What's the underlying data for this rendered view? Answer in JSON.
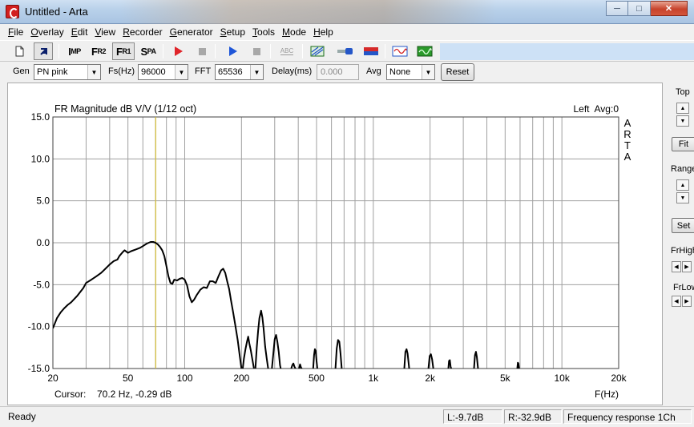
{
  "window": {
    "title": "Untitled - Arta"
  },
  "menu": [
    {
      "label": "File",
      "ul": "F",
      "rest": "ile"
    },
    {
      "label": "Overlay",
      "ul": "O",
      "rest": "verlay"
    },
    {
      "label": "Edit",
      "ul": "E",
      "rest": "dit"
    },
    {
      "label": "View",
      "ul": "V",
      "rest": "iew"
    },
    {
      "label": "Recorder",
      "ul": "R",
      "rest": "ecorder"
    },
    {
      "label": "Generator",
      "ul": "G",
      "rest": "enerator"
    },
    {
      "label": "Setup",
      "ul": "S",
      "rest": "etup"
    },
    {
      "label": "Tools",
      "ul": "T",
      "rest": "ools"
    },
    {
      "label": "Mode",
      "ul": "M",
      "rest": "ode"
    },
    {
      "label": "Help",
      "ul": "H",
      "rest": "elp"
    }
  ],
  "toolbar": {
    "imp": {
      "big": "I",
      "small": "MP"
    },
    "fr2": {
      "big": "F",
      "small": "R2"
    },
    "fr1": {
      "big": "F",
      "small": "R1"
    },
    "spa": {
      "big": "S",
      "small": "PA"
    },
    "abc": "ABC",
    "icons": [
      "new-document-icon",
      "cursor-arrow-icon",
      "record-icon",
      "stop-icon",
      "play-icon",
      "stop-icon",
      "abc-icon",
      "grid-window-icon",
      "probe-icon",
      "level-meter-icon",
      "waveform-icon",
      "oscilloscope-icon"
    ],
    "colors": {
      "record": "#e0252a",
      "play": "#1f56d8",
      "accent_green": "#2b9a2b",
      "accent_blue": "#2456c8",
      "accent_red": "#d62a2a"
    }
  },
  "genbar": {
    "gen_label": "Gen",
    "gen_value": "PN pink",
    "fs_label": "Fs(Hz)",
    "fs_value": "96000",
    "fft_label": "FFT",
    "fft_value": "65536",
    "delay_label": "Delay(ms)",
    "delay_value": "0.000",
    "avg_label": "Avg",
    "avg_value": "None",
    "reset_label": "Reset"
  },
  "chart_data": {
    "type": "line",
    "title": "FR Magnitude dB V/V (1/12 oct)",
    "channel_info": "Left  Avg:0",
    "side_label": [
      "A",
      "R",
      "T",
      "A"
    ],
    "xlabel": "F(Hz)",
    "xscale": "log",
    "xlim": [
      20,
      20000
    ],
    "ylim": [
      -15,
      15
    ],
    "y_ticks": [
      "15.0",
      "10.0",
      "5.0",
      "0.0",
      "-5.0",
      "-10.0",
      "-15.0"
    ],
    "x_ticks": [
      {
        "f": 20,
        "label": "20"
      },
      {
        "f": 50,
        "label": "50"
      },
      {
        "f": 100,
        "label": "100"
      },
      {
        "f": 200,
        "label": "200"
      },
      {
        "f": 500,
        "label": "500"
      },
      {
        "f": 1000,
        "label": "1k"
      },
      {
        "f": 2000,
        "label": "2k"
      },
      {
        "f": 5000,
        "label": "5k"
      },
      {
        "f": 10000,
        "label": "10k"
      },
      {
        "f": 20000,
        "label": "20k"
      }
    ],
    "grid": true,
    "cursor": {
      "label": "Cursor:",
      "text": "70.2 Hz, -0.29 dB",
      "f": 70.2,
      "color": "#d8c23a"
    },
    "series": [
      {
        "color": "#000000",
        "points": [
          [
            20,
            -10.2
          ],
          [
            21,
            -9.0
          ],
          [
            22,
            -8.3
          ],
          [
            23,
            -7.8
          ],
          [
            24,
            -7.4
          ],
          [
            25,
            -7.1
          ],
          [
            27,
            -6.3
          ],
          [
            29,
            -5.4
          ],
          [
            30,
            -4.8
          ],
          [
            32,
            -4.4
          ],
          [
            34,
            -4.0
          ],
          [
            36,
            -3.6
          ],
          [
            38,
            -3.1
          ],
          [
            40,
            -2.6
          ],
          [
            42,
            -2.2
          ],
          [
            44,
            -2.0
          ],
          [
            45,
            -1.6
          ],
          [
            47,
            -1.1
          ],
          [
            48,
            -0.9
          ],
          [
            50,
            -1.2
          ],
          [
            52,
            -1.0
          ],
          [
            55,
            -0.8
          ],
          [
            58,
            -0.6
          ],
          [
            60,
            -0.4
          ],
          [
            63,
            -0.1
          ],
          [
            66,
            0.1
          ],
          [
            68,
            0.1
          ],
          [
            70,
            0.0
          ],
          [
            72,
            -0.2
          ],
          [
            74,
            -0.5
          ],
          [
            76,
            -0.9
          ],
          [
            78,
            -1.6
          ],
          [
            80,
            -2.8
          ],
          [
            82,
            -4.0
          ],
          [
            84,
            -4.8
          ],
          [
            86,
            -4.9
          ],
          [
            88,
            -4.4
          ],
          [
            91,
            -4.5
          ],
          [
            94,
            -4.3
          ],
          [
            97,
            -4.2
          ],
          [
            100,
            -4.4
          ],
          [
            103,
            -5.1
          ],
          [
            106,
            -6.4
          ],
          [
            109,
            -7.1
          ],
          [
            112,
            -6.8
          ],
          [
            116,
            -6.2
          ],
          [
            121,
            -5.6
          ],
          [
            126,
            -5.3
          ],
          [
            131,
            -5.4
          ],
          [
            136,
            -4.6
          ],
          [
            141,
            -4.6
          ],
          [
            146,
            -4.8
          ],
          [
            151,
            -4.0
          ],
          [
            156,
            -3.3
          ],
          [
            160,
            -3.1
          ],
          [
            164,
            -3.6
          ],
          [
            168,
            -4.6
          ],
          [
            172,
            -5.5
          ],
          [
            176,
            -6.9
          ],
          [
            181,
            -8.4
          ],
          [
            186,
            -10.0
          ],
          [
            191,
            -11.6
          ],
          [
            196,
            -13.6
          ],
          [
            200,
            -15.0
          ]
        ],
        "segments": [
          [
            [
              203,
              -15.0
            ],
            [
              206,
              -13.8
            ],
            [
              210,
              -12.7
            ],
            [
              214,
              -11.8
            ],
            [
              217,
              -11.2
            ],
            [
              220,
              -12.0
            ],
            [
              224,
              -12.8
            ],
            [
              228,
              -13.8
            ],
            [
              233,
              -15.0
            ]
          ],
          [
            [
              237,
              -15.0
            ],
            [
              241,
              -12.5
            ],
            [
              245,
              -10.5
            ],
            [
              249,
              -9.0
            ],
            [
              254,
              -8.1
            ],
            [
              258,
              -8.9
            ],
            [
              262,
              -10.2
            ],
            [
              267,
              -12.4
            ],
            [
              272,
              -13.8
            ],
            [
              277,
              -15.0
            ]
          ],
          [
            [
              290,
              -15.0
            ],
            [
              295,
              -13.2
            ],
            [
              300,
              -11.5
            ],
            [
              305,
              -11.0
            ],
            [
              310,
              -11.8
            ],
            [
              315,
              -13.0
            ],
            [
              320,
              -14.6
            ],
            [
              323,
              -15.0
            ]
          ],
          [
            [
              367,
              -15.0
            ],
            [
              372,
              -14.6
            ],
            [
              377,
              -14.4
            ],
            [
              382,
              -14.8
            ],
            [
              387,
              -15.0
            ]
          ],
          [
            [
              404,
              -15.0
            ],
            [
              409,
              -14.5
            ],
            [
              414,
              -14.9
            ],
            [
              418,
              -15.0
            ]
          ],
          [
            [
              480,
              -15.0
            ],
            [
              485,
              -13.4
            ],
            [
              490,
              -12.7
            ],
            [
              495,
              -12.9
            ],
            [
              500,
              -14.1
            ],
            [
              505,
              -15.0
            ]
          ],
          [
            [
              630,
              -15.0
            ],
            [
              640,
              -12.6
            ],
            [
              650,
              -11.6
            ],
            [
              660,
              -11.8
            ],
            [
              670,
              -13.2
            ],
            [
              680,
              -15.0
            ]
          ],
          [
            [
              1460,
              -15.0
            ],
            [
              1480,
              -13.0
            ],
            [
              1500,
              -12.7
            ],
            [
              1520,
              -13.2
            ],
            [
              1550,
              -15.0
            ]
          ],
          [
            [
              1960,
              -15.0
            ],
            [
              1990,
              -13.5
            ],
            [
              2020,
              -13.3
            ],
            [
              2050,
              -13.9
            ],
            [
              2080,
              -15.0
            ]
          ],
          [
            [
              2500,
              -15.0
            ],
            [
              2520,
              -14.1
            ],
            [
              2545,
              -14.0
            ],
            [
              2570,
              -14.8
            ],
            [
              2590,
              -15.0
            ]
          ],
          [
            [
              3420,
              -15.0
            ],
            [
              3460,
              -13.4
            ],
            [
              3500,
              -13.0
            ],
            [
              3540,
              -13.6
            ],
            [
              3590,
              -15.0
            ]
          ],
          [
            [
              5800,
              -15.0
            ],
            [
              5840,
              -14.3
            ],
            [
              5880,
              -14.4
            ],
            [
              5930,
              -15.0
            ]
          ]
        ]
      }
    ]
  },
  "right_panel": {
    "top_label": "Top",
    "fit_label": "Fit",
    "range_label": "Range",
    "set_label": "Set",
    "frhigh_label": "FrHigh",
    "frlow_label": "FrLow"
  },
  "status": {
    "ready": "Ready",
    "left_level": "L:-9.7dB",
    "right_level": "R:-32.9dB",
    "mode": "Frequency response 1Ch"
  }
}
